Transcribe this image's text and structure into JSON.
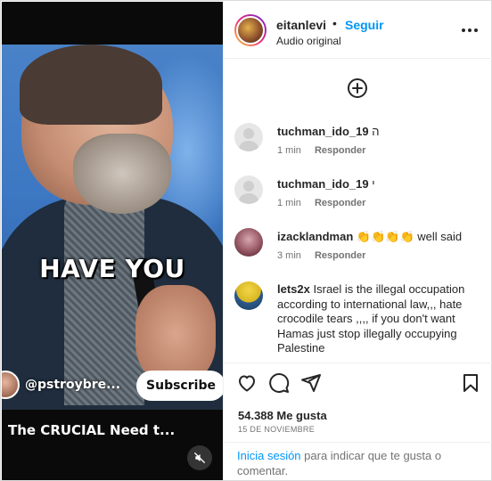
{
  "video": {
    "overlay_text": "HAVE YOU",
    "channel_handle": "@pstroybre...",
    "subscribe_label": "Subscribe",
    "caption": "The CRUCIAL Need t..."
  },
  "header": {
    "username": "eitanlevi",
    "dot": "•",
    "follow_label": "Seguir",
    "audio_label": "Audio original"
  },
  "comments": [
    {
      "username": "tuchman_ido_19",
      "text": "ה",
      "time": "1 min",
      "reply": "Responder"
    },
    {
      "username": "tuchman_ido_19",
      "text": "י",
      "time": "1 min",
      "reply": "Responder"
    },
    {
      "username": "izacklandman",
      "text": "👏👏👏👏 well said",
      "time": "3 min",
      "reply": "Responder"
    },
    {
      "username": "lets2x",
      "text": "Israel is the illegal occupation according to international law,,, hate crocodile tears ,,,, if you don't want Hamas just stop illegally occupying Palestine",
      "time": "",
      "reply": ""
    }
  ],
  "actions": {
    "likes": "54.388 Me gusta",
    "date": "15 DE NOVIEMBRE",
    "login_link": "Inicia sesión",
    "login_rest": " para indicar que te gusta o comentar."
  },
  "colors": {
    "accent_blue": "#0095f6",
    "text": "#262626",
    "muted": "#737373",
    "border": "#dbdbdb"
  },
  "icons": [
    "more-icon",
    "add-comment-icon",
    "heart-icon",
    "comment-icon",
    "share-icon",
    "bookmark-icon",
    "mute-icon"
  ]
}
